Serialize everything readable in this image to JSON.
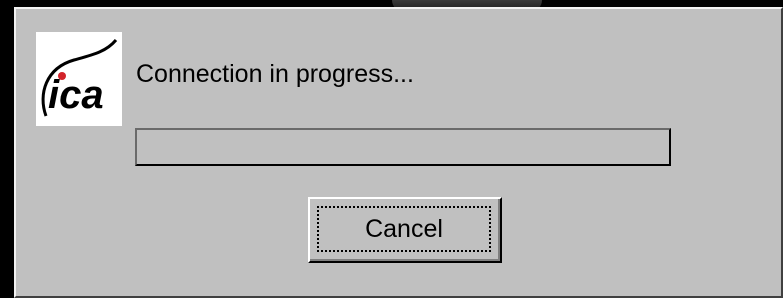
{
  "logo": {
    "text": "ica",
    "icon": "ica-logo-icon"
  },
  "dialog": {
    "message": "Connection in progress...",
    "progress": 0,
    "cancel_label": "Cancel"
  },
  "colors": {
    "dialog_bg": "#c0c0c0",
    "screen_bg": "#000000",
    "progress_fill": "#000080"
  }
}
